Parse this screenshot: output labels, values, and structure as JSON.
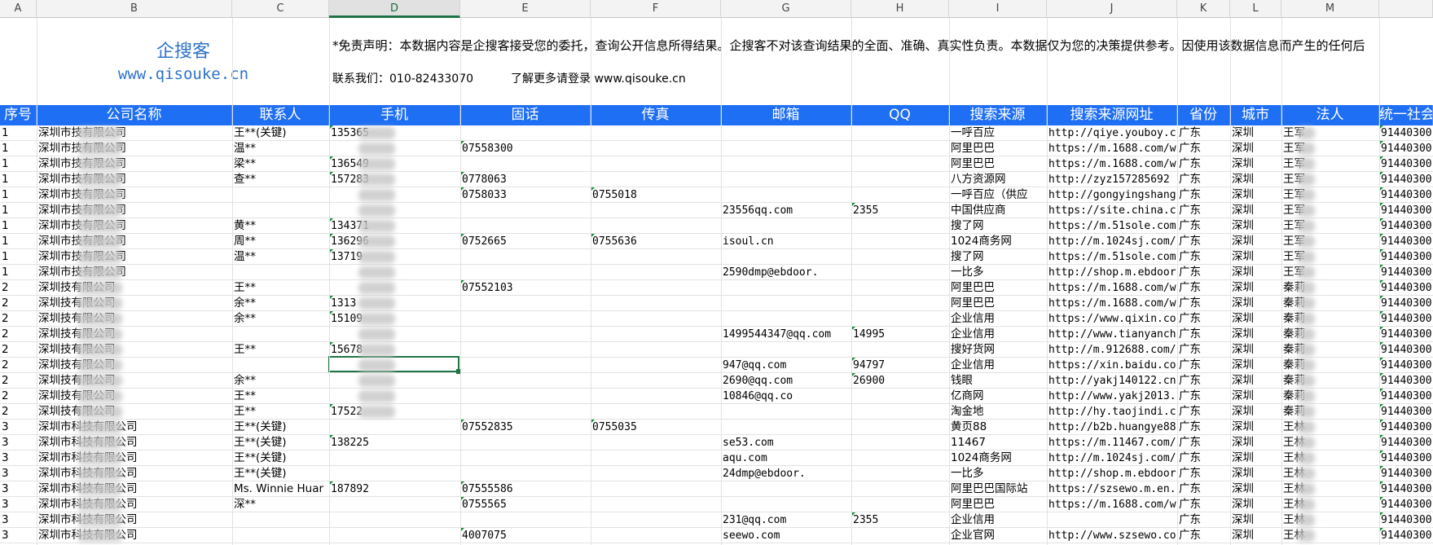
{
  "columns": [
    "A",
    "B",
    "C",
    "D",
    "E",
    "F",
    "G",
    "H",
    "I",
    "J",
    "K",
    "L",
    "M",
    ""
  ],
  "banner": {
    "title": "企搜客",
    "url": "www.qisouke.cn",
    "disclaimer": "*免责声明：本数据内容是企搜客接受您的委托，查询公开信息所得结果。企搜客不对该查询结果的全面、准确、真实性负责。本数据仅为您的决策提供参考。因使用该数据信息而产生的任何后",
    "contact": "联系我们：010-82433070",
    "more": "了解更多请登录 www.qisouke.cn"
  },
  "headers": [
    "序号",
    "公司名称",
    "联系人",
    "手机",
    "固话",
    "传真",
    "邮箱",
    "QQ",
    "搜索来源",
    "搜索来源网址",
    "省份",
    "城市",
    "法人",
    "统一社会"
  ],
  "colors": {
    "header_bg": "#1f6ff4",
    "brand": "#2f73c8",
    "selection": "#217346"
  },
  "rows": [
    {
      "seq": "1",
      "company": "深圳市技有限公司",
      "contact": "王**(关键)",
      "mobile": "135365",
      "tel": "",
      "fax": "",
      "email": "",
      "qq": "",
      "source": "一呼百应",
      "url": "http://qiye.youboy.c",
      "province": "广东",
      "city": "深圳",
      "legal": "王军",
      "uscc": "91440300"
    },
    {
      "seq": "1",
      "company": "深圳市技有限公司",
      "contact": "温**",
      "mobile": "",
      "tel": "07558300",
      "fax": "",
      "email": "",
      "qq": "",
      "source": "阿里巴巴",
      "url": "https://m.1688.com/w",
      "province": "广东",
      "city": "深圳",
      "legal": "王军",
      "uscc": "91440300"
    },
    {
      "seq": "1",
      "company": "深圳市技有限公司",
      "contact": "梁**",
      "mobile": "136549",
      "tel": "",
      "fax": "",
      "email": "",
      "qq": "",
      "source": "阿里巴巴",
      "url": "https://m.1688.com/w",
      "province": "广东",
      "city": "深圳",
      "legal": "王军",
      "uscc": "91440300"
    },
    {
      "seq": "1",
      "company": "深圳市技有限公司",
      "contact": "查**",
      "mobile": "157283",
      "tel": "0778063",
      "fax": "",
      "email": "",
      "qq": "",
      "source": "八方资源网",
      "url": "http://zyz157285692",
      "province": "广东",
      "city": "深圳",
      "legal": "王军",
      "uscc": "91440300"
    },
    {
      "seq": "1",
      "company": "深圳市技有限公司",
      "contact": "",
      "mobile": "",
      "tel": "0758033",
      "fax": "0755018",
      "email": "",
      "qq": "",
      "source": "一呼百应（供应",
      "url": "http://gongyingshang",
      "province": "广东",
      "city": "深圳",
      "legal": "王军",
      "uscc": "91440300"
    },
    {
      "seq": "1",
      "company": "深圳市技有限公司",
      "contact": "",
      "mobile": "",
      "tel": "",
      "fax": "",
      "email": "23556qq.com",
      "qq": "2355",
      "source": "中国供应商",
      "url": "https://site.china.c",
      "province": "广东",
      "city": "深圳",
      "legal": "王军",
      "uscc": "91440300"
    },
    {
      "seq": "1",
      "company": "深圳市技有限公司",
      "contact": "黄**",
      "mobile": "134371",
      "tel": "",
      "fax": "",
      "email": "",
      "qq": "",
      "source": "搜了网",
      "url": "https://m.51sole.com",
      "province": "广东",
      "city": "深圳",
      "legal": "王军",
      "uscc": "91440300"
    },
    {
      "seq": "1",
      "company": "深圳市技有限公司",
      "contact": "周**",
      "mobile": "136296",
      "tel": "0752665",
      "fax": "0755636",
      "email": "isoul.cn",
      "qq": "",
      "source": "1024商务网",
      "url": "http://m.1024sj.com/",
      "province": "广东",
      "city": "深圳",
      "legal": "王军",
      "uscc": "91440300"
    },
    {
      "seq": "1",
      "company": "深圳市技有限公司",
      "contact": "温**",
      "mobile": "13719",
      "tel": "",
      "fax": "",
      "email": "",
      "qq": "",
      "source": "搜了网",
      "url": "https://m.51sole.com",
      "province": "广东",
      "city": "深圳",
      "legal": "王军",
      "uscc": "91440300"
    },
    {
      "seq": "1",
      "company": "深圳市技有限公司",
      "contact": "",
      "mobile": "",
      "tel": "",
      "fax": "",
      "email": "2590dmp@ebdoor.",
      "qq": "",
      "source": "一比多",
      "url": "http://shop.m.ebdoor",
      "province": "广东",
      "city": "深圳",
      "legal": "王军",
      "uscc": "91440300"
    },
    {
      "seq": "2",
      "company": "深圳技有限公司",
      "contact": "王**",
      "mobile": "",
      "tel": "07552103",
      "fax": "",
      "email": "",
      "qq": "",
      "source": "阿里巴巴",
      "url": "https://m.1688.com/w",
      "province": "广东",
      "city": "深圳",
      "legal": "秦莉",
      "uscc": "91440300"
    },
    {
      "seq": "2",
      "company": "深圳技有限公司",
      "contact": "余**",
      "mobile": "1313",
      "tel": "",
      "fax": "",
      "email": "",
      "qq": "",
      "source": "阿里巴巴",
      "url": "https://m.1688.com/w",
      "province": "广东",
      "city": "深圳",
      "legal": "秦莉",
      "uscc": "91440300"
    },
    {
      "seq": "2",
      "company": "深圳技有限公司",
      "contact": "余**",
      "mobile": "15109",
      "tel": "",
      "fax": "",
      "email": "",
      "qq": "",
      "source": "企业信用",
      "url": "https://www.qixin.co",
      "province": "广东",
      "city": "深圳",
      "legal": "秦莉",
      "uscc": "91440300"
    },
    {
      "seq": "2",
      "company": "深圳技有限公司",
      "contact": "",
      "mobile": "",
      "tel": "",
      "fax": "",
      "email": "1499544347@qq.com",
      "qq": "14995",
      "source": "企业信用",
      "url": "http://www.tianyanch",
      "province": "广东",
      "city": "深圳",
      "legal": "秦莉",
      "uscc": "91440300"
    },
    {
      "seq": "2",
      "company": "深圳技有限公司",
      "contact": "王**",
      "mobile": "15678",
      "tel": "",
      "fax": "",
      "email": "",
      "qq": "",
      "source": "搜好货网",
      "url": "http://m.912688.com/",
      "province": "广东",
      "city": "深圳",
      "legal": "秦莉",
      "uscc": "91440300"
    },
    {
      "seq": "2",
      "company": "深圳技有限公司",
      "contact": "",
      "mobile": "",
      "tel": "",
      "fax": "",
      "email": "947@qq.com",
      "qq": "94797",
      "source": "企业信用",
      "url": "https://xin.baidu.co",
      "province": "广东",
      "city": "深圳",
      "legal": "秦莉",
      "uscc": "91440300"
    },
    {
      "seq": "2",
      "company": "深圳技有限公司",
      "contact": "余**",
      "mobile": "",
      "tel": "",
      "fax": "",
      "email": "2690@qq.com",
      "qq": "26900",
      "source": "钱眼",
      "url": "http://yakj140122.cn",
      "province": "广东",
      "city": "深圳",
      "legal": "秦莉",
      "uscc": "91440300"
    },
    {
      "seq": "2",
      "company": "深圳技有限公司",
      "contact": "王**",
      "mobile": "",
      "tel": "",
      "fax": "",
      "email": "10846@qq.co",
      "qq": "",
      "source": "亿商网",
      "url": "http://www.yakj2013.",
      "province": "广东",
      "city": "深圳",
      "legal": "秦莉",
      "uscc": "91440300"
    },
    {
      "seq": "2",
      "company": "深圳技有限公司",
      "contact": "王**",
      "mobile": "17522",
      "tel": "",
      "fax": "",
      "email": "",
      "qq": "",
      "source": "淘金地",
      "url": "http://hy.taojindi.c",
      "province": "广东",
      "city": "深圳",
      "legal": "秦莉",
      "uscc": "91440300"
    },
    {
      "seq": "3",
      "company": "深圳市科技有限公司",
      "contact": "王**(关键)",
      "mobile": "",
      "tel": "07552835",
      "fax": "0755035",
      "email": "",
      "qq": "",
      "source": "黄页88",
      "url": "http://b2b.huangye88",
      "province": "广东",
      "city": "深圳",
      "legal": "王林",
      "uscc": "91440300"
    },
    {
      "seq": "3",
      "company": "深圳市科技有限公司",
      "contact": "王**(关键)",
      "mobile": "138225",
      "tel": "",
      "fax": "",
      "email": "se53.com",
      "qq": "",
      "source": "11467",
      "url": "https://m.11467.com/",
      "province": "广东",
      "city": "深圳",
      "legal": "王林",
      "uscc": "91440300"
    },
    {
      "seq": "3",
      "company": "深圳市科技有限公司",
      "contact": "王**(关键)",
      "mobile": "",
      "tel": "",
      "fax": "",
      "email": "aqu.com",
      "qq": "",
      "source": "1024商务网",
      "url": "http://m.1024sj.com/",
      "province": "广东",
      "city": "深圳",
      "legal": "王林",
      "uscc": "91440300"
    },
    {
      "seq": "3",
      "company": "深圳市科技有限公司",
      "contact": "王**(关键)",
      "mobile": "",
      "tel": "",
      "fax": "",
      "email": "24dmp@ebdoor.",
      "qq": "",
      "source": "一比多",
      "url": "http://shop.m.ebdoor",
      "province": "广东",
      "city": "深圳",
      "legal": "王林",
      "uscc": "91440300"
    },
    {
      "seq": "3",
      "company": "深圳市科技有限公司",
      "contact": "Ms. Winnie Huar",
      "mobile": "187892",
      "tel": "07555586",
      "fax": "",
      "email": "",
      "qq": "",
      "source": "阿里巴巴国际站",
      "url": "https://szsewo.m.en.",
      "province": "广东",
      "city": "深圳",
      "legal": "王林",
      "uscc": "91440300"
    },
    {
      "seq": "3",
      "company": "深圳市科技有限公司",
      "contact": "深**",
      "mobile": "",
      "tel": "0755565",
      "fax": "",
      "email": "",
      "qq": "",
      "source": "阿里巴巴",
      "url": "https://m.1688.com/w",
      "province": "广东",
      "city": "深圳",
      "legal": "王林",
      "uscc": "91440300"
    },
    {
      "seq": "3",
      "company": "深圳市科技有限公司",
      "contact": "",
      "mobile": "",
      "tel": "",
      "fax": "",
      "email": "231@qq.com",
      "qq": "2355",
      "source": "企业信用",
      "url": "",
      "province": "广东",
      "city": "深圳",
      "legal": "王林",
      "uscc": "91440300"
    },
    {
      "seq": "3",
      "company": "深圳市科技有限公司",
      "contact": "",
      "mobile": "",
      "tel": "4007075",
      "fax": "",
      "email": "seewo.com",
      "qq": "",
      "source": "企业官网",
      "url": "http://www.szsewo.co",
      "province": "广东",
      "city": "深圳",
      "legal": "王林",
      "uscc": "91440300"
    }
  ]
}
